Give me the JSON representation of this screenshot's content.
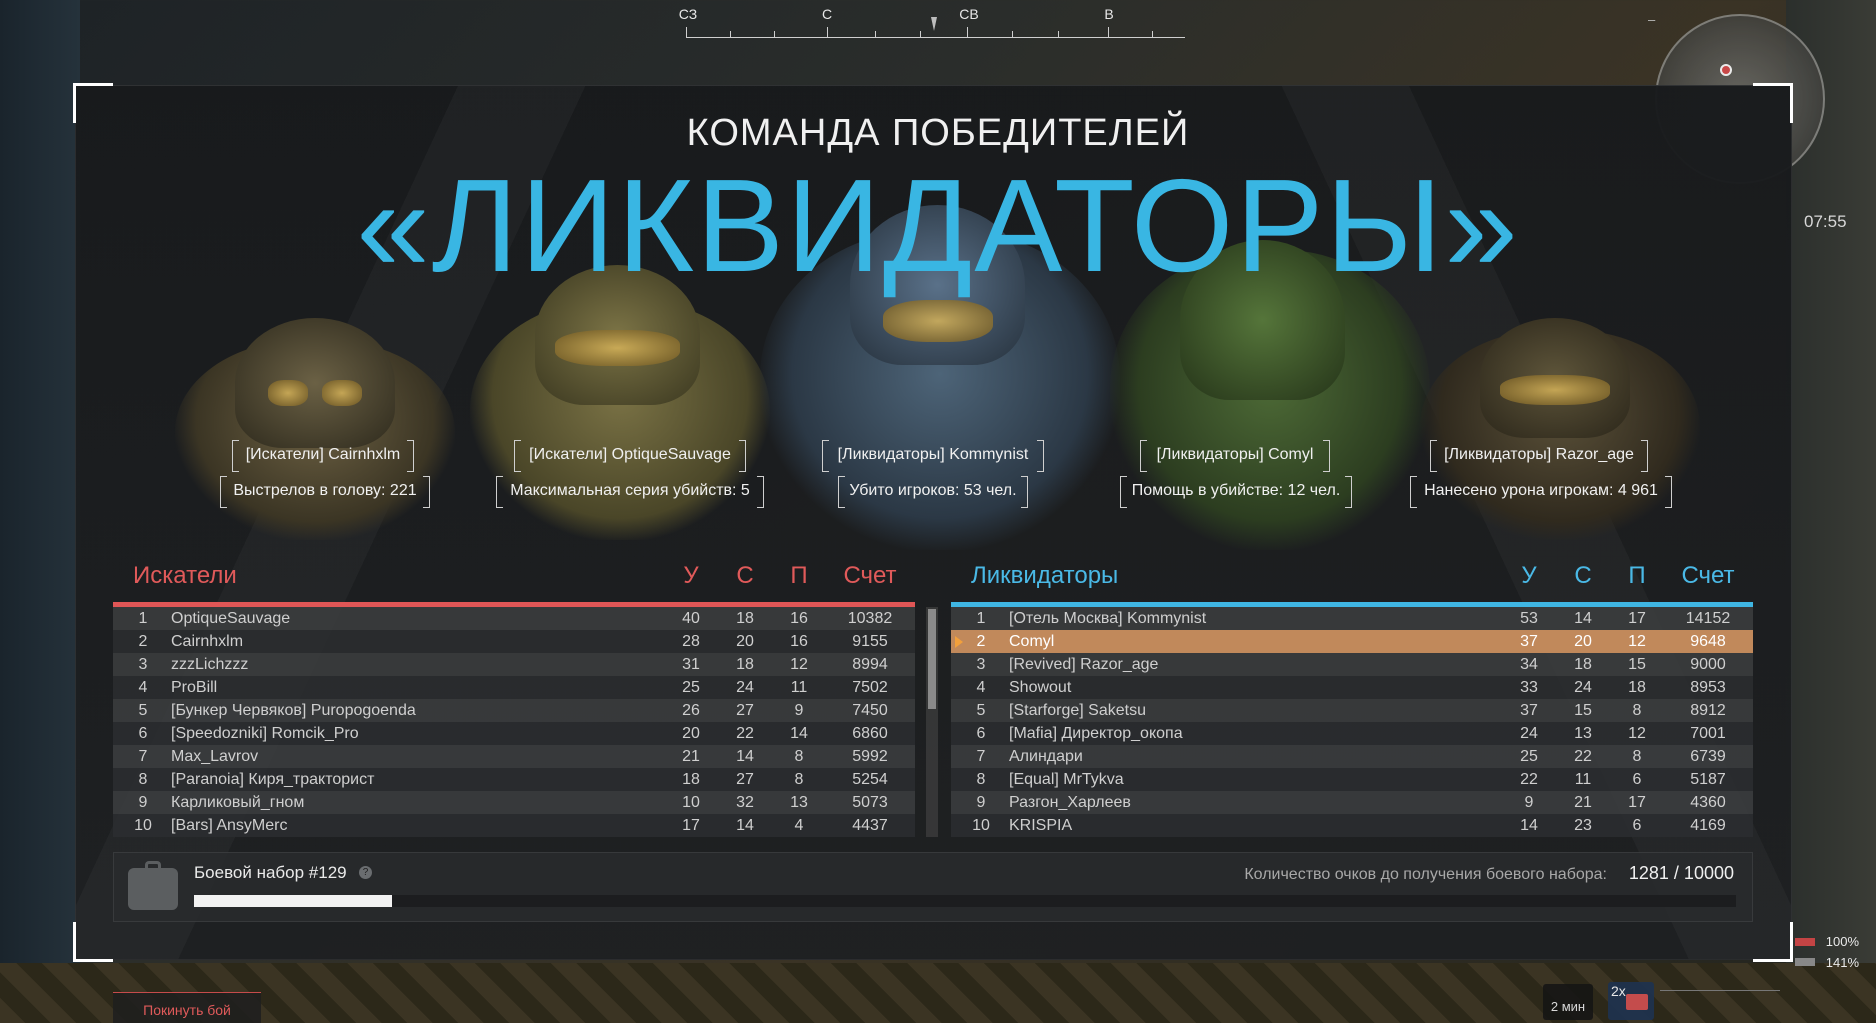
{
  "compass": {
    "labels": [
      {
        "text": "СЗ"
      },
      {
        "text": "С"
      },
      {
        "text": "СВ"
      },
      {
        "text": "В"
      }
    ]
  },
  "hud": {
    "match_timer": "07:55",
    "minimize": "–",
    "pct_1": "100%",
    "pct_2": "141%",
    "time_left": "2 мин",
    "multiplier": "2x"
  },
  "header": {
    "subtitle": "КОМАНДА ПОБЕДИТЕЛЕЙ",
    "winner_team": "«ЛИКВИДАТОРЫ»"
  },
  "highlights": [
    {
      "player": "[Искатели] Cairnhxlm",
      "stat": "Выстрелов в голову: 221"
    },
    {
      "player": "[Искатели] OptiqueSauvage",
      "stat": "Максимальная серия убийств: 5"
    },
    {
      "player": "[Ликвидаторы] Kommynist",
      "stat": "Убито игроков: 53 чел."
    },
    {
      "player": "[Ликвидаторы] Comyl",
      "stat": "Помощь в убийстве: 12 чел."
    },
    {
      "player": "[Ликвидаторы] Razor_age",
      "stat": "Нанесено урона игрокам: 4 961"
    }
  ],
  "columns": {
    "kills": "У",
    "deaths": "С",
    "assists": "П",
    "score": "Счет"
  },
  "teams": {
    "a": {
      "name": "Искатели",
      "color": "#e05656",
      "rows": [
        {
          "rank": "1",
          "name": "OptiqueSauvage",
          "k": "40",
          "d": "18",
          "a": "16",
          "score": "10382"
        },
        {
          "rank": "2",
          "name": "Cairnhxlm",
          "k": "28",
          "d": "20",
          "a": "16",
          "score": "9155"
        },
        {
          "rank": "3",
          "name": "zzzLichzzz",
          "k": "31",
          "d": "18",
          "a": "12",
          "score": "8994"
        },
        {
          "rank": "4",
          "name": "ProBill",
          "k": "25",
          "d": "24",
          "a": "11",
          "score": "7502"
        },
        {
          "rank": "5",
          "name": "[Бункер Червяков] Puropogoenda",
          "k": "26",
          "d": "27",
          "a": "9",
          "score": "7450"
        },
        {
          "rank": "6",
          "name": "[Speedozniki] Romcik_Pro",
          "k": "20",
          "d": "22",
          "a": "14",
          "score": "6860"
        },
        {
          "rank": "7",
          "name": "Max_Lavrov",
          "k": "21",
          "d": "14",
          "a": "8",
          "score": "5992"
        },
        {
          "rank": "8",
          "name": "[Paranoia] Киря_тракторист",
          "k": "18",
          "d": "27",
          "a": "8",
          "score": "5254"
        },
        {
          "rank": "9",
          "name": "Карликовый_гном",
          "k": "10",
          "d": "32",
          "a": "13",
          "score": "5073"
        },
        {
          "rank": "10",
          "name": "[Bars] AnsyMerc",
          "k": "17",
          "d": "14",
          "a": "4",
          "score": "4437"
        }
      ]
    },
    "b": {
      "name": "Ликвидаторы",
      "color": "#3fb6e3",
      "rows": [
        {
          "rank": "1",
          "name": "[Отель Москва] Kommynist",
          "k": "53",
          "d": "14",
          "a": "17",
          "score": "14152"
        },
        {
          "rank": "2",
          "name": "Comyl",
          "k": "37",
          "d": "20",
          "a": "12",
          "score": "9648"
        },
        {
          "rank": "3",
          "name": "[Revived] Razor_age",
          "k": "34",
          "d": "18",
          "a": "15",
          "score": "9000"
        },
        {
          "rank": "4",
          "name": "Showout",
          "k": "33",
          "d": "24",
          "a": "18",
          "score": "8953"
        },
        {
          "rank": "5",
          "name": "[Starforge] Saketsu",
          "k": "37",
          "d": "15",
          "a": "8",
          "score": "8912"
        },
        {
          "rank": "6",
          "name": "[Mafia] Директор_окопа",
          "k": "24",
          "d": "13",
          "a": "12",
          "score": "7001"
        },
        {
          "rank": "7",
          "name": "Алиндари",
          "k": "25",
          "d": "22",
          "a": "8",
          "score": "6739"
        },
        {
          "rank": "8",
          "name": "[Equal] MrTykva",
          "k": "22",
          "d": "11",
          "a": "6",
          "score": "5187"
        },
        {
          "rank": "9",
          "name": "Разгон_Харлеев",
          "k": "9",
          "d": "21",
          "a": "17",
          "score": "4360"
        },
        {
          "rank": "10",
          "name": "KRISPIA",
          "k": "14",
          "d": "23",
          "a": "6",
          "score": "4169"
        }
      ]
    }
  },
  "battle_pack": {
    "title": "Боевой набор #129",
    "help": "?",
    "requirement_label": "Количество очков до получения боевого набора:",
    "progress_text": "1281 / 10000",
    "progress_fraction": 0.1281
  },
  "leave_button": "Покинуть бой"
}
